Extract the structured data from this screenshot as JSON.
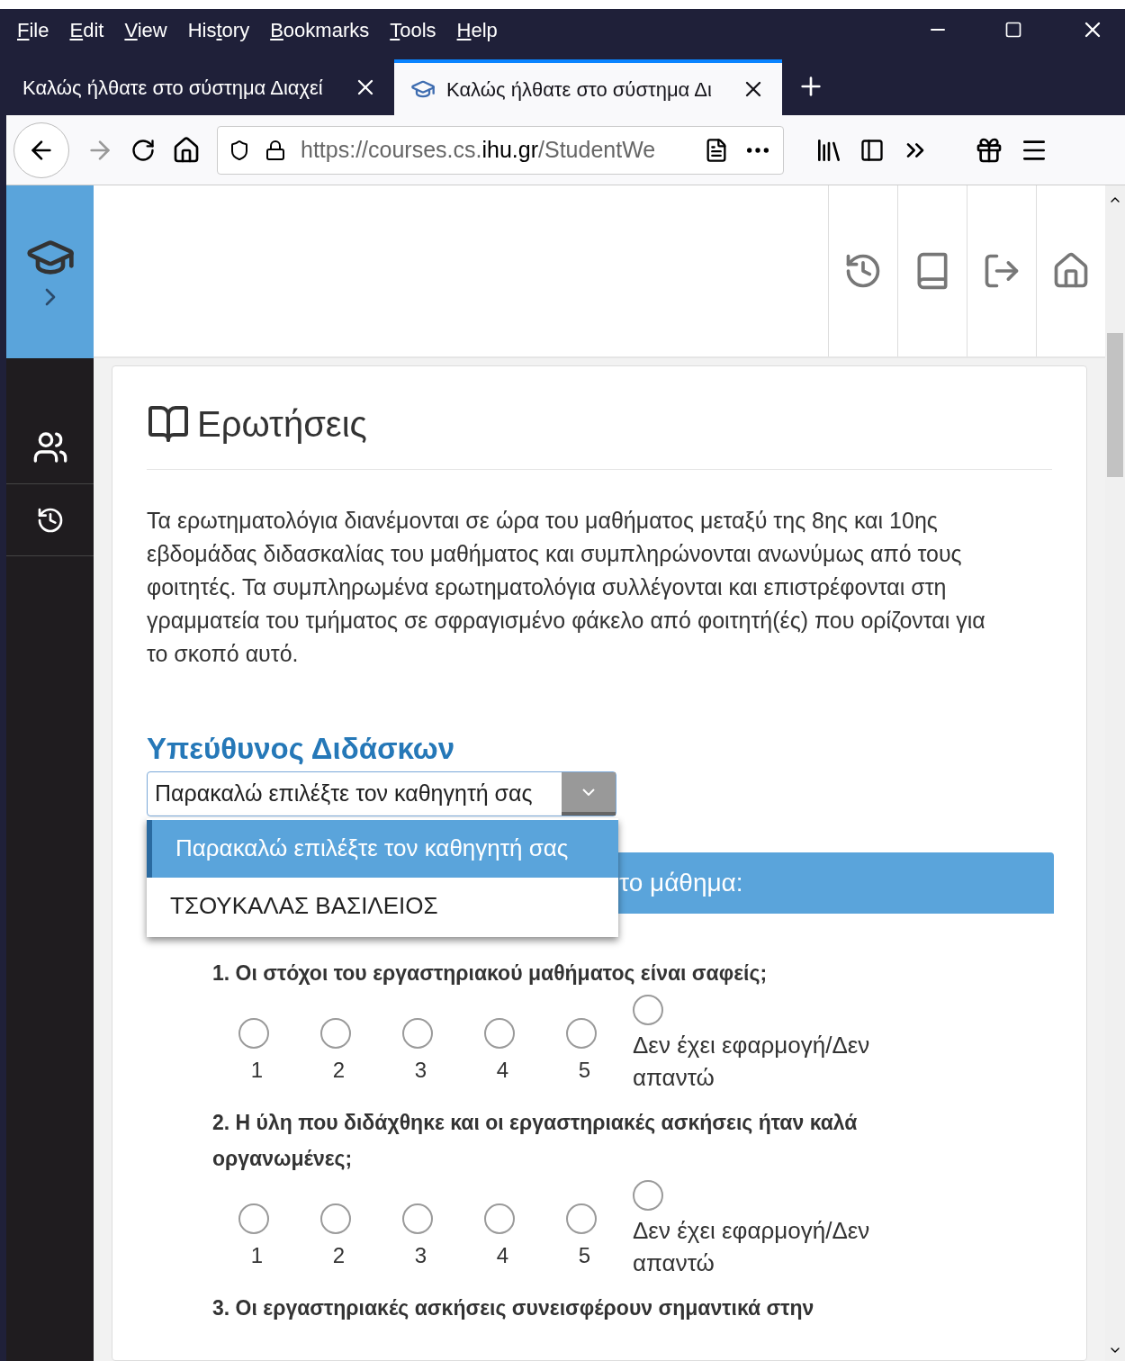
{
  "menu": [
    {
      "accel": "F",
      "after": "ile"
    },
    {
      "accel": "E",
      "after": "dit"
    },
    {
      "accel": "V",
      "after": "iew"
    },
    {
      "before": "His",
      "accel": "t",
      "after": "ory"
    },
    {
      "accel": "B",
      "after": "ookmarks"
    },
    {
      "accel": "T",
      "after": "ools"
    },
    {
      "accel": "H",
      "after": "elp"
    }
  ],
  "tabs": [
    {
      "title": "Καλώς ήλθατε στο σύστημα Διαχεί",
      "selected": false
    },
    {
      "title": "Καλώς ήλθατε στο σύστημα Δι",
      "selected": true
    }
  ],
  "url": {
    "prefix": "https://courses.cs.",
    "domain": "ihu.gr",
    "path": "/StudentWe"
  },
  "page": {
    "title": "Ερωτήσεις",
    "intro": "Τα ερωτηματολόγια διανέμονται σε ώρα του μαθήματος μεταξύ της 8ης και 10ης εβδομάδας διδασκαλίας του μαθήματος και συμπληρώνονται ανωνύμως από τους φοιτητές. Τα συμπληρωμένα ερωτηματολόγια συλλέγονται και επιστρέφονται στη γραμματεία του τμήματος σε σφραγισμένο φάκελο από φοιτητή(ές) που ορίζονται για το σκοπό αυτό.",
    "instructor_label": "Υπεύθυνος Διδάσκων",
    "select": {
      "value": "Παρακαλώ επιλέξτε τον καθηγητή σας",
      "expanded": true,
      "options": [
        {
          "label": "Παρακαλώ επιλέξτε τον καθηγητή σας",
          "selected": true
        },
        {
          "label": "ΤΣΟΥΚΑΛΑΣ ΒΑΣΙΛΕΙΟΣ",
          "selected": false
        }
      ]
    },
    "section_bar": "το μάθημα:",
    "questions": [
      {
        "text": "1. Οι στόχοι του εργαστηριακού μαθήματος είναι σαφείς;",
        "options": [
          {
            "label": "1",
            "selected": false
          },
          {
            "label": "2",
            "selected": false
          },
          {
            "label": "3",
            "selected": false
          },
          {
            "label": "4",
            "selected": false
          },
          {
            "label": "5",
            "selected": false
          }
        ],
        "na": {
          "label": "Δεν έχει εφαρμογή/Δεν απαντώ",
          "selected": false
        }
      },
      {
        "text": "2. Η ύλη που διδάχθηκε και οι εργαστηριακές ασκήσεις ήταν καλά οργανωμένες;",
        "options": [
          {
            "label": "1",
            "selected": false
          },
          {
            "label": "2",
            "selected": false
          },
          {
            "label": "3",
            "selected": false
          },
          {
            "label": "4",
            "selected": false
          },
          {
            "label": "5",
            "selected": false
          }
        ],
        "na": {
          "label": "Δεν έχει εφαρμογή/Δεν απαντώ",
          "selected": false
        }
      },
      {
        "text": "3. Οι εργαστηριακές ασκήσεις συνεισφέρουν σημαντικά στην"
      }
    ]
  }
}
